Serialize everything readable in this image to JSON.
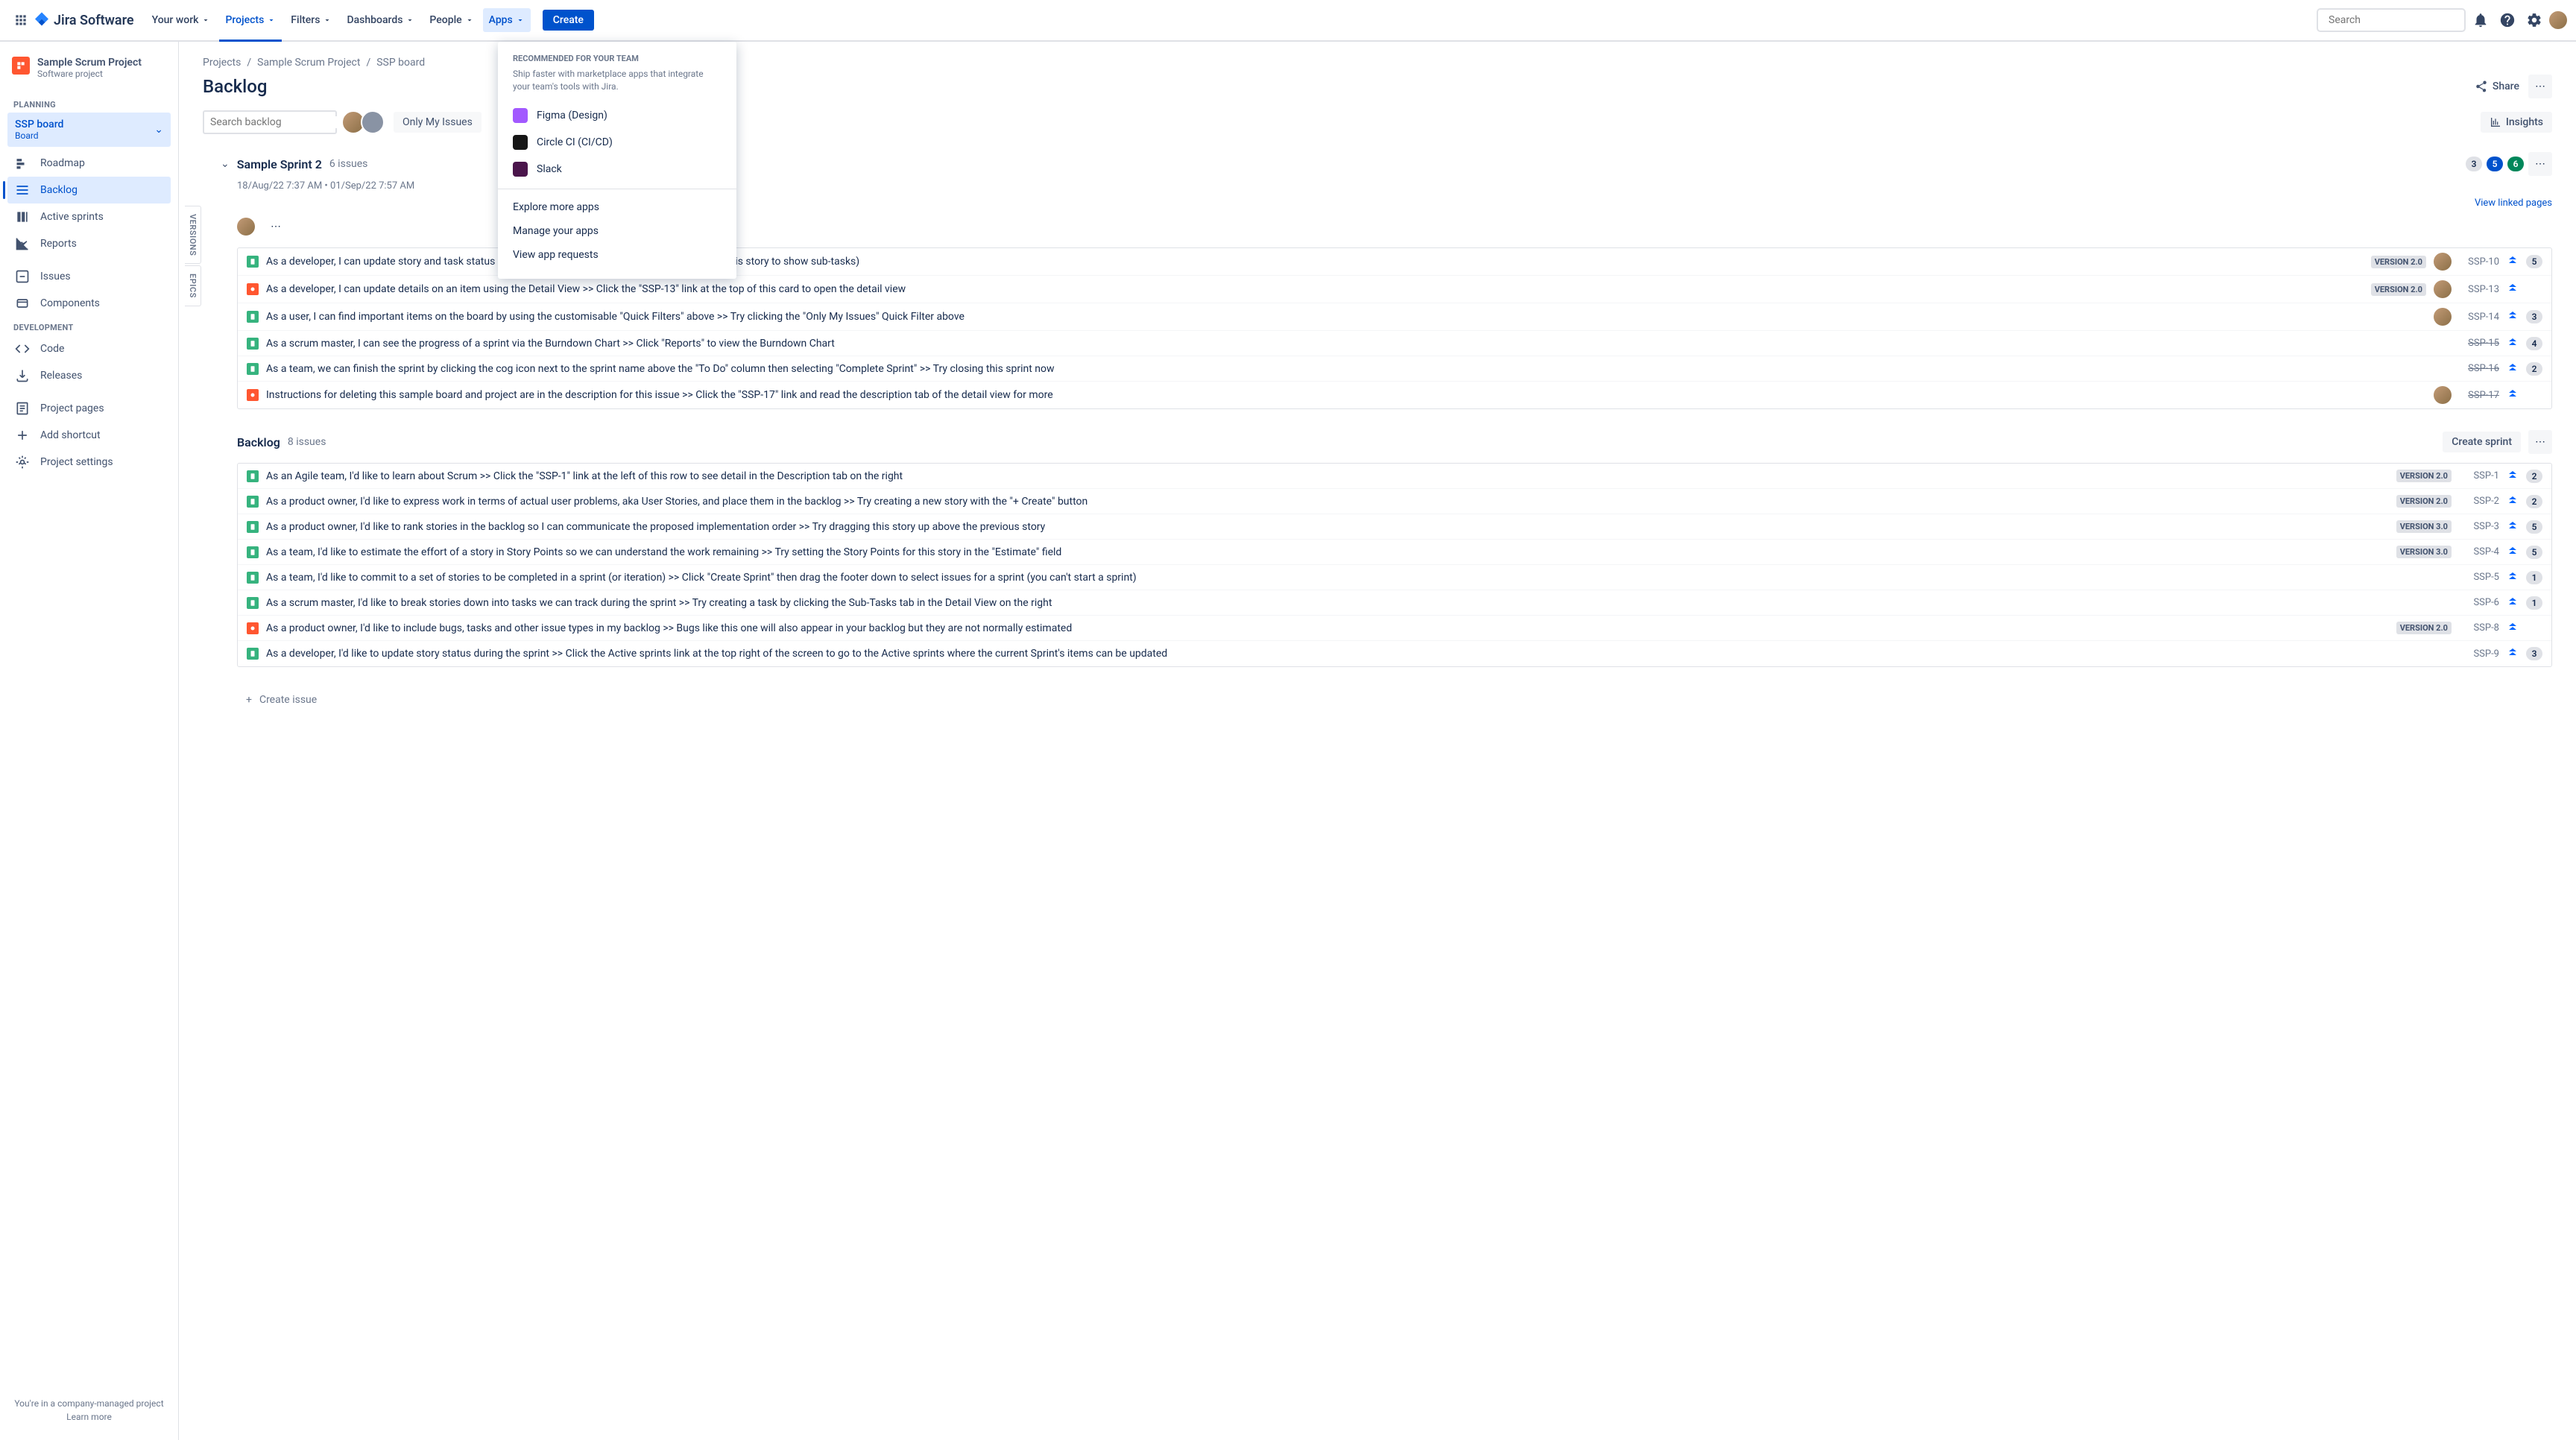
{
  "nav": {
    "logo": "Jira Software",
    "items": [
      "Your work",
      "Projects",
      "Filters",
      "Dashboards",
      "People",
      "Apps"
    ],
    "create": "Create",
    "search_placeholder": "Search"
  },
  "dropdown": {
    "section_label": "RECOMMENDED FOR YOUR TEAM",
    "description": "Ship faster with marketplace apps that integrate your team's tools with Jira.",
    "apps": [
      {
        "name": "Figma (Design)",
        "color": "#a259ff"
      },
      {
        "name": "Circle CI (CI/CD)",
        "color": "#161616"
      },
      {
        "name": "Slack",
        "color": "#4a154b"
      }
    ],
    "links": [
      "Explore more apps",
      "Manage your apps",
      "View app requests"
    ]
  },
  "sidebar": {
    "project_name": "Sample Scrum Project",
    "project_type": "Software project",
    "planning_label": "PLANNING",
    "board_name": "SSP board",
    "board_sub": "Board",
    "planning_items": [
      "Roadmap",
      "Backlog",
      "Active sprints",
      "Reports"
    ],
    "other_items": [
      "Issues",
      "Components"
    ],
    "development_label": "DEVELOPMENT",
    "dev_items": [
      "Code",
      "Releases"
    ],
    "more_items": [
      "Project pages",
      "Add shortcut",
      "Project settings"
    ],
    "footer_text": "You're in a company-managed project",
    "footer_link": "Learn more"
  },
  "breadcrumb": [
    "Projects",
    "Sample Scrum Project",
    "SSP board"
  ],
  "page_title": "Backlog",
  "share": "Share",
  "search_backlog_placeholder": "Search backlog",
  "only_my_issues": "Only My Issues",
  "insights": "Insights",
  "vtabs": [
    "VERSIONS",
    "EPICS"
  ],
  "sprint": {
    "name": "Sample Sprint 2",
    "count": "6 issues",
    "dates": "18/Aug/22 7:37 AM • 01/Sep/22 7:57 AM",
    "badges": [
      "3",
      "5",
      "6"
    ],
    "view_linked": "View linked pages",
    "issues": [
      {
        "type": "story",
        "summary": "As a developer, I can update story and task status with drag and drop (click the triangle at far left of this story to show sub-tasks)",
        "version": "VERSION 2.0",
        "assignee": true,
        "key": "SSP-10",
        "est": "5",
        "done": false
      },
      {
        "type": "bug",
        "summary": "As a developer, I can update details on an item using the Detail View >> Click the \"SSP-13\" link at the top of this card to open the detail view",
        "version": "VERSION 2.0",
        "assignee": true,
        "key": "SSP-13",
        "est": "",
        "done": false
      },
      {
        "type": "story",
        "summary": "As a user, I can find important items on the board by using the customisable \"Quick Filters\" above >> Try clicking the \"Only My Issues\" Quick Filter above",
        "version": "",
        "assignee": true,
        "key": "SSP-14",
        "est": "3",
        "done": false
      },
      {
        "type": "story",
        "summary": "As a scrum master, I can see the progress of a sprint via the Burndown Chart >> Click \"Reports\" to view the Burndown Chart",
        "version": "",
        "assignee": false,
        "key": "SSP-15",
        "est": "4",
        "done": true
      },
      {
        "type": "story",
        "summary": "As a team, we can finish the sprint by clicking the cog icon next to the sprint name above the \"To Do\" column then selecting \"Complete Sprint\" >> Try closing this sprint now",
        "version": "",
        "assignee": false,
        "key": "SSP-16",
        "est": "2",
        "done": true
      },
      {
        "type": "bug",
        "summary": "Instructions for deleting this sample board and project are in the description for this issue >> Click the \"SSP-17\" link and read the description tab of the detail view for more",
        "version": "",
        "assignee": true,
        "key": "SSP-17",
        "est": "",
        "done": true
      }
    ]
  },
  "backlog": {
    "name": "Backlog",
    "count": "8 issues",
    "create_sprint": "Create sprint",
    "issues": [
      {
        "type": "story",
        "summary": "As an Agile team, I'd like to learn about Scrum >> Click the \"SSP-1\" link at the left of this row to see detail in the Description tab on the right",
        "version": "VERSION 2.0",
        "key": "SSP-1",
        "est": "2"
      },
      {
        "type": "story",
        "summary": "As a product owner, I'd like to express work in terms of actual user problems, aka User Stories, and place them in the backlog >> Try creating a new story with the \"+ Create\" button",
        "version": "VERSION 2.0",
        "key": "SSP-2",
        "est": "2"
      },
      {
        "type": "story",
        "summary": "As a product owner, I'd like to rank stories in the backlog so I can communicate the proposed implementation order >> Try dragging this story up above the previous story",
        "version": "VERSION 3.0",
        "key": "SSP-3",
        "est": "5"
      },
      {
        "type": "story",
        "summary": "As a team, I'd like to estimate the effort of a story in Story Points so we can understand the work remaining >> Try setting the Story Points for this story in the \"Estimate\" field",
        "version": "VERSION 3.0",
        "key": "SSP-4",
        "est": "5"
      },
      {
        "type": "story",
        "summary": "As a team, I'd like to commit to a set of stories to be completed in a sprint (or iteration) >> Click \"Create Sprint\" then drag the footer down to select issues for a sprint (you can't start a sprint)",
        "version": "",
        "key": "SSP-5",
        "est": "1"
      },
      {
        "type": "story",
        "summary": "As a scrum master, I'd like to break stories down into tasks we can track during the sprint >> Try creating a task by clicking the Sub-Tasks tab in the Detail View on the right",
        "version": "",
        "key": "SSP-6",
        "est": "1"
      },
      {
        "type": "bug",
        "summary": "As a product owner, I'd like to include bugs, tasks and other issue types in my backlog >> Bugs like this one will also appear in your backlog but they are not normally estimated",
        "version": "VERSION 2.0",
        "key": "SSP-8",
        "est": ""
      },
      {
        "type": "story",
        "summary": "As a developer, I'd like to update story status during the sprint >> Click the Active sprints link at the top right of the screen to go to the Active sprints where the current Sprint's items can be updated",
        "version": "",
        "key": "SSP-9",
        "est": "3"
      }
    ]
  },
  "create_issue": "Create issue"
}
